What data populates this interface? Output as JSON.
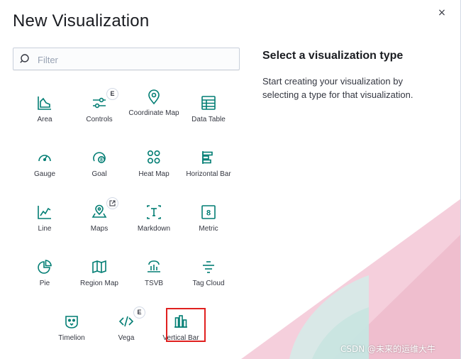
{
  "modal": {
    "title": "New Visualization",
    "close_label": "×",
    "search": {
      "placeholder": "Filter",
      "value": ""
    },
    "panel": {
      "heading": "Select a visualization type",
      "description": "Start creating your visualization by selecting a type for that visualization."
    },
    "types": [
      {
        "label": "Area",
        "icon": "area-chart-icon"
      },
      {
        "label": "Controls",
        "icon": "controls-icon",
        "badge": "E"
      },
      {
        "label": "Coordinate Map",
        "icon": "map-pin-icon"
      },
      {
        "label": "Data Table",
        "icon": "table-icon"
      },
      {
        "label": "Gauge",
        "icon": "gauge-icon"
      },
      {
        "label": "Goal",
        "icon": "goal-icon"
      },
      {
        "label": "Heat Map",
        "icon": "heatmap-icon"
      },
      {
        "label": "Horizontal Bar",
        "icon": "horizontal-bar-icon"
      },
      {
        "label": "Line",
        "icon": "line-chart-icon"
      },
      {
        "label": "Maps",
        "icon": "maps-icon",
        "badge_icon": "external-link-icon"
      },
      {
        "label": "Markdown",
        "icon": "markdown-icon"
      },
      {
        "label": "Metric",
        "icon": "metric-icon"
      },
      {
        "label": "Pie",
        "icon": "pie-chart-icon"
      },
      {
        "label": "Region Map",
        "icon": "region-map-icon"
      },
      {
        "label": "TSVB",
        "icon": "tsvb-icon"
      },
      {
        "label": "Tag Cloud",
        "icon": "tag-cloud-icon"
      },
      {
        "label": "Timelion",
        "icon": "timelion-icon"
      },
      {
        "label": "Vega",
        "icon": "code-icon",
        "badge": "E"
      },
      {
        "label": "Vertical Bar",
        "icon": "vertical-bar-icon"
      }
    ]
  },
  "watermark": "CSDN @未来的运维大牛",
  "colors": {
    "accent": "#017d73",
    "text": "#343741",
    "highlight": "#e0201f",
    "deco_pink": "#f2c4d3",
    "deco_teal": "#d3ece9"
  }
}
